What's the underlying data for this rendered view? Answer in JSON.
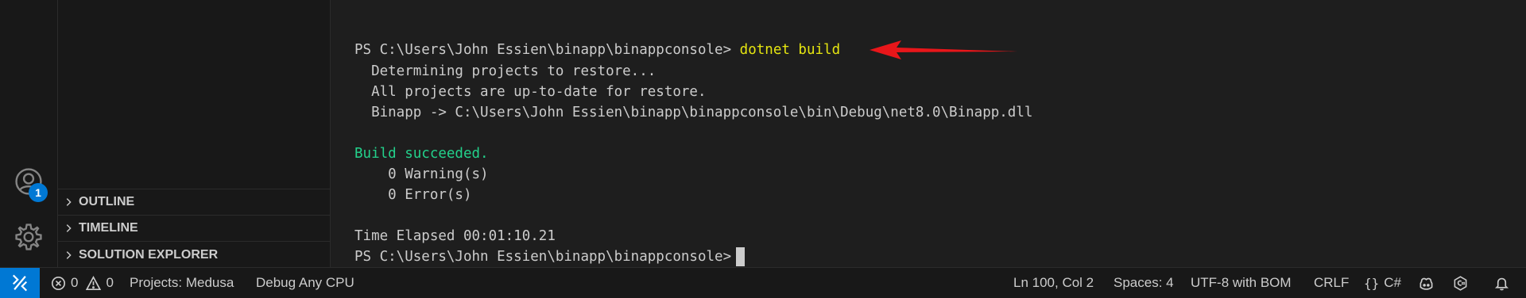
{
  "activity_bar": {
    "accounts_badge": "1"
  },
  "sidebar": {
    "sections": [
      {
        "label": "OUTLINE"
      },
      {
        "label": "TIMELINE"
      },
      {
        "label": "SOLUTION EXPLORER"
      }
    ]
  },
  "terminal": {
    "prompt1": "PS C:\\Users\\John Essien\\binapp\\binappconsole>",
    "command": "dotnet build",
    "out1": "  Determining projects to restore...",
    "out2": "  All projects are up-to-date for restore.",
    "out3": "  Binapp -> C:\\Users\\John Essien\\binapp\\binappconsole\\bin\\Debug\\net8.0\\Binapp.dll",
    "success": "Build succeeded.",
    "warnings": "    0 Warning(s)",
    "errors": "    0 Error(s)",
    "elapsed": "Time Elapsed 00:01:10.21",
    "prompt2": "PS C:\\Users\\John Essien\\binapp\\binappconsole>"
  },
  "annotation": {
    "arrow_color": "#e8161a"
  },
  "status_bar": {
    "errors_count": "0",
    "warnings_count": "0",
    "project": "Projects: Medusa",
    "config": "Debug Any CPU",
    "position": "Ln 100, Col 2",
    "indent": "Spaces: 4",
    "encoding": "UTF-8 with BOM",
    "eol": "CRLF",
    "language": "C#"
  },
  "colors": {
    "accent": "#0078d4",
    "terminal_yellow": "#e5e510",
    "terminal_green": "#23d18b"
  }
}
